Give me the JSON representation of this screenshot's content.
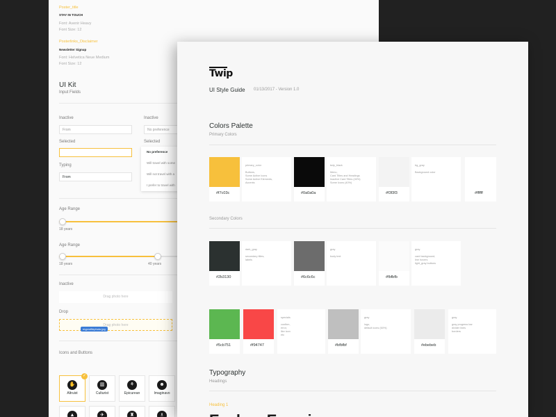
{
  "back": {
    "poster_title": {
      "label": "Poster_title",
      "text": "STAY IN TOUCH",
      "font": "Font: Avenir Heavy",
      "size": "Font Size: 12"
    },
    "poster_links": {
      "label": "Posterlinks_Disclaimer",
      "text": "Newsletter Signup",
      "font": "Font: Helvetica Neue Medium",
      "size": "Font Size: 12"
    },
    "ui_kit_title": "UI Kit",
    "input_fields": "Input Fields",
    "inputs": {
      "inactive_label": "Inactive",
      "inactive_value": "From",
      "selected_label": "Selected",
      "typing_label": "Typing",
      "typing_value": "From",
      "inactive2_label": "Inactive",
      "inactive2_value": "No preference",
      "selected2_label": "Selected"
    },
    "dropdown": [
      "No preference",
      "Will travel with some",
      "Will not travel with a",
      "I prefer to travel with"
    ],
    "age_range_1": {
      "label": "Age Range",
      "min": "18 years"
    },
    "age_range_2": {
      "label": "Age Range",
      "min": "18 years",
      "max": "40 years"
    },
    "photo_inactive": {
      "label": "Inactive",
      "text": "Drag photo here"
    },
    "photo_drop": {
      "label": "Drop",
      "text": "Drag photo here",
      "file": "myprofilephoto.jpg"
    },
    "icons_title": "Icons and Buttons",
    "icons": [
      {
        "name": "Altruist",
        "icon": "hand-heart-icon",
        "glyph": "✋"
      },
      {
        "name": "Culturist",
        "icon": "columns-icon",
        "glyph": "▥"
      },
      {
        "name": "Epicurean",
        "icon": "utensils-icon",
        "glyph": "⚘"
      },
      {
        "name": "Imaginavo",
        "icon": "mask-icon",
        "glyph": "☻"
      }
    ],
    "icons_row2": [
      "▲",
      "✈",
      "♜",
      "♗"
    ]
  },
  "front": {
    "logo": "Twip",
    "title": "UI Style Guide",
    "date": "01/13/2017 - Version 1.0",
    "colors_title": "Colors Palette",
    "primary_label": "Primary Colors",
    "primary": [
      {
        "hex": "#f7c03c",
        "color": "#f7c03c",
        "desc": "primary_color\n\nButtons,\nSome Active Icons\nSome Active Elements,\nAccents"
      },
      {
        "hex": "#0a0a0a",
        "color": "#0a0a0a",
        "desc": "twip_black\n\nMenu,\nCard Titles and Headings\nInactive Card Titles (40%)\nSome Icons (40%)"
      },
      {
        "hex": "#f3f3f3",
        "color": "#f3f3f3",
        "desc": "bg_gray\n\nBackground color"
      },
      {
        "hex": "#ffffff",
        "color": "#ffffff",
        "desc": ""
      }
    ],
    "secondary_label": "Secondary Colors",
    "secondary": [
      {
        "hex": "#2b3130",
        "color": "#2b3130",
        "desc": "dark_gray\n\nsecondary titles,\nlabels"
      },
      {
        "hex": "#6c6c6c",
        "color": "#6c6c6c",
        "desc": "gray\n\nbody text"
      },
      {
        "hex": "#fbfbfb",
        "color": "#fbfbfb",
        "desc": "gray\n\ncard background,\nline hovers\nlight_gray buttons"
      }
    ],
    "tertiary": [
      {
        "hex": "#5cb751",
        "color": "#5cb751",
        "desc": ""
      },
      {
        "hex": "#f94747",
        "color": "#f94747",
        "desc": "specials\n\nconfirm,\nerror,\nlike icon\netc"
      },
      {
        "hex": "#bfbfbf",
        "color": "#bfbfbf",
        "desc": "gray\n\nlogo,\ndefault icons (60%)"
      },
      {
        "hex": "#ebebeb",
        "color": "#ebebeb",
        "desc": "gray\n\ngray progress bar\ndivider lines\nborders"
      }
    ],
    "typography_title": "Typography",
    "headings_label": "Headings",
    "heading1_label": "Heading 1",
    "heading1_sample": "Explore Experiences"
  }
}
